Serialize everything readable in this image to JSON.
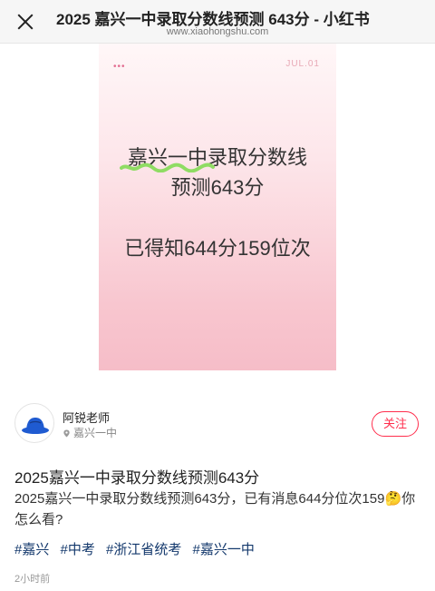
{
  "browser": {
    "title": "2025 嘉兴一中录取分数线预测 643分 - 小红书",
    "url": "www.xiaohongshu.com"
  },
  "image_card": {
    "dots": "•••",
    "stamp": "JUL.01",
    "headline_line1": "嘉兴一中录取分数线",
    "headline_line2": "预测643分",
    "headline_line3": "已得知644分159位次"
  },
  "author": {
    "name": "阿锐老师",
    "location": "嘉兴一中",
    "follow_label": "关注"
  },
  "post": {
    "title": "2025嘉兴一中录取分数线预测643分",
    "body": "2025嘉兴一中录取分数线预测643分，已有消息644分位次159🤔你怎么看?",
    "tags": [
      "#嘉兴",
      "#中考",
      "#浙江省统考",
      "#嘉兴一中"
    ],
    "time": "2小时前"
  },
  "colors": {
    "accent": "#ff2e4d",
    "tag": "#13386c"
  }
}
